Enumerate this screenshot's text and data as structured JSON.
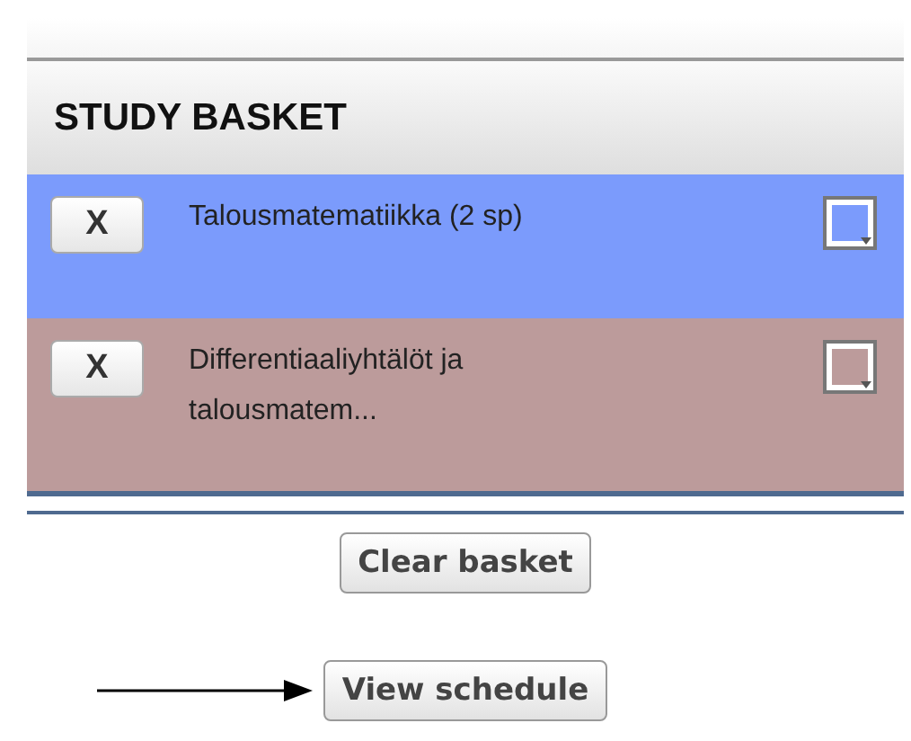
{
  "basket": {
    "title": "STUDY BASKET",
    "items": [
      {
        "remove": "X",
        "name": "Talousmatematiikka (2 sp)",
        "color": "#7b9bfc"
      },
      {
        "remove": "X",
        "name": "Differentiaaliyhtälöt ja talousmatem...",
        "color": "#bc9b9b"
      }
    ]
  },
  "buttons": [
    {
      "label": "Clear basket",
      "arrow": false
    },
    {
      "label": "View schedule",
      "arrow": true
    }
  ]
}
